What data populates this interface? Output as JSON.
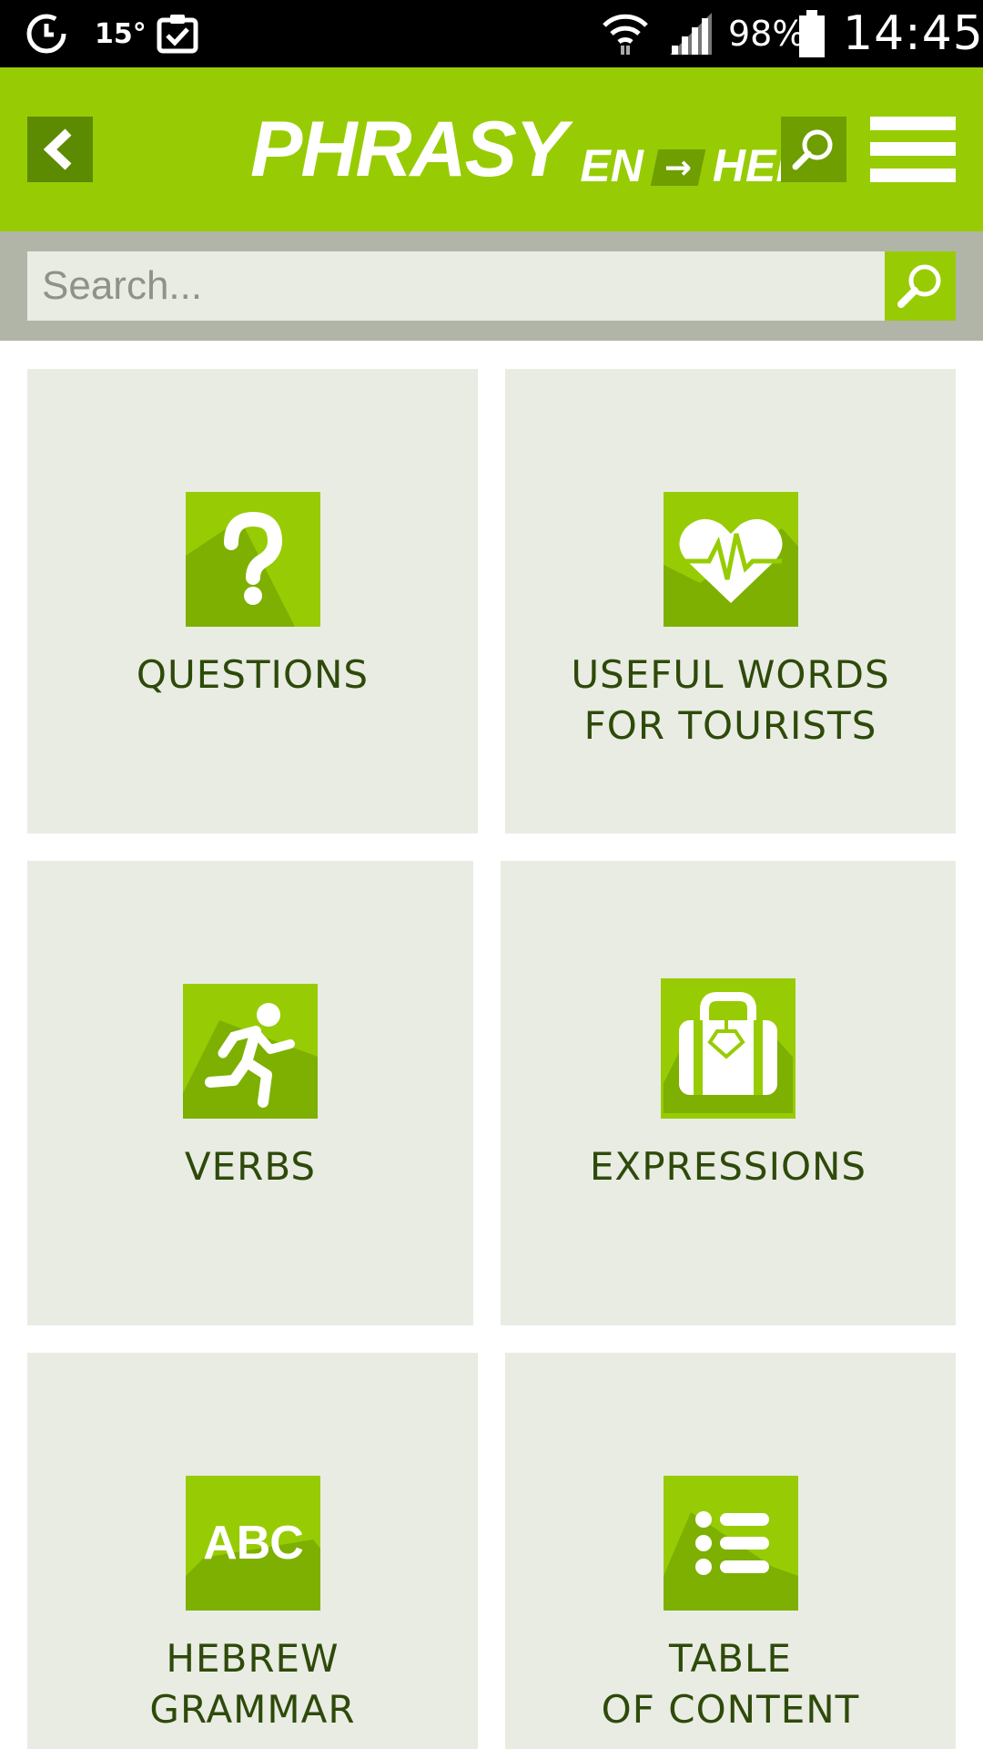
{
  "status_bar": {
    "temperature": "15°",
    "battery_percent": "98%",
    "time": "14:45",
    "icons": [
      "sync-icon",
      "clipboard-check-icon",
      "wifi-icon",
      "signal-icon",
      "battery-icon"
    ]
  },
  "header": {
    "logo_main": "PHRASY",
    "logo_from": "EN",
    "logo_arrow": "→",
    "logo_to": "HEB",
    "icons": [
      "back-arrow-icon",
      "search-icon",
      "hamburger-menu-icon"
    ]
  },
  "search": {
    "placeholder": "Search..."
  },
  "tiles": [
    {
      "line1": "QUESTIONS",
      "line2": "",
      "icon": "question-mark-icon"
    },
    {
      "line1": "USEFUL WORDS",
      "line2": "FOR TOURISTS",
      "icon": "heartbeat-icon"
    },
    {
      "line1": "VERBS",
      "line2": "",
      "icon": "running-man-icon"
    },
    {
      "line1": "EXPRESSIONS",
      "line2": "",
      "icon": "suitcase-icon"
    },
    {
      "line1": "HEBREW",
      "line2": "GRAMMAR",
      "icon": "abc-icon"
    },
    {
      "line1": "TABLE",
      "line2": "OF CONTENT",
      "icon": "list-icon"
    }
  ],
  "tiles_icon_text": {
    "abc": "ABC"
  },
  "colors": {
    "accent": "#97cc04",
    "accent_dark": "#5c8a00",
    "tile_bg": "#e9ece3",
    "search_strip": "#b0b5a8",
    "label_text": "#2e4a0a"
  }
}
